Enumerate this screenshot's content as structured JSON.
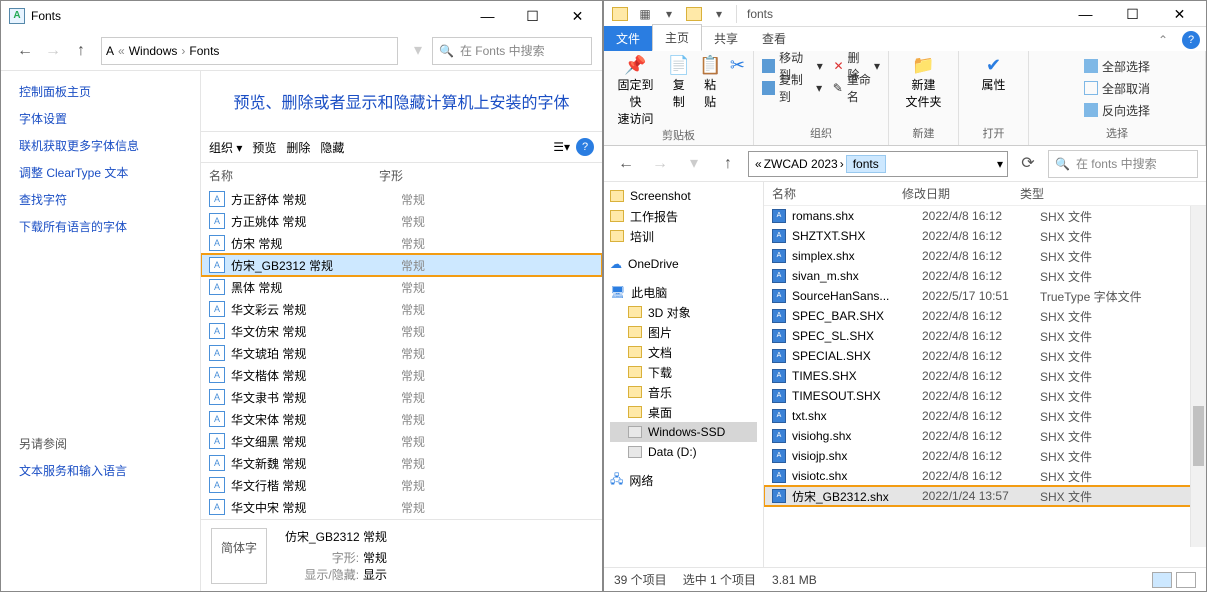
{
  "left": {
    "title": "Fonts",
    "winbtns": {
      "min": "—",
      "max": "☐",
      "close": "✕"
    },
    "nav": {
      "back": "←",
      "fwd": "→",
      "up": "↑"
    },
    "crumbs": [
      "Windows",
      "Fonts"
    ],
    "search_ph": "在 Fonts 中搜索",
    "side": {
      "home": "控制面板主页",
      "links": [
        "字体设置",
        "联机获取更多字体信息",
        "调整 ClearType 文本",
        "查找字符",
        "下载所有语言的字体"
      ],
      "seealso": "另请参阅",
      "seealso_link": "文本服务和输入语言"
    },
    "heading": "预览、删除或者显示和隐藏计算机上安装的字体",
    "toolbar": {
      "org": "组织",
      "drop": "▾",
      "preview": "预览",
      "delete": "删除",
      "hide": "隐藏",
      "viewicon": "☰▾",
      "help": "?"
    },
    "columns": {
      "name": "名称",
      "style": "字形"
    },
    "rows": [
      {
        "n": "方正舒体 常规",
        "s": "常规"
      },
      {
        "n": "方正姚体 常规",
        "s": "常规"
      },
      {
        "n": "仿宋 常规",
        "s": "常规"
      },
      {
        "n": "仿宋_GB2312 常规",
        "s": "常规",
        "sel": true,
        "hi": true
      },
      {
        "n": "黑体 常规",
        "s": "常规"
      },
      {
        "n": "华文彩云 常规",
        "s": "常规"
      },
      {
        "n": "华文仿宋 常规",
        "s": "常规"
      },
      {
        "n": "华文琥珀 常规",
        "s": "常规"
      },
      {
        "n": "华文楷体 常规",
        "s": "常规"
      },
      {
        "n": "华文隶书 常规",
        "s": "常规"
      },
      {
        "n": "华文宋体 常规",
        "s": "常规"
      },
      {
        "n": "华文细黑 常规",
        "s": "常规"
      },
      {
        "n": "华文新魏 常规",
        "s": "常规"
      },
      {
        "n": "华文行楷 常规",
        "s": "常规"
      },
      {
        "n": "华文中宋 常规",
        "s": "常规"
      }
    ],
    "preview": {
      "thumb": "简体字",
      "name": "仿宋_GB2312 常规",
      "k1": "字形:",
      "v1": "常规",
      "k2": "显示/隐藏:",
      "v2": "显示"
    }
  },
  "right": {
    "qat_title": "fonts",
    "winbtns": {
      "min": "—",
      "max": "☐",
      "close": "✕"
    },
    "tabs": {
      "file": "文件",
      "home": "主页",
      "share": "共享",
      "view": "查看"
    },
    "ribbon": {
      "pin": {
        "icon": "📌",
        "l1": "固定到快",
        "l2": "速访问"
      },
      "copy": {
        "icon": "📄",
        "l": "复制"
      },
      "paste": {
        "icon": "📋",
        "l": "粘贴"
      },
      "cut": {
        "icon": "✂"
      },
      "clip_lbl": "剪贴板",
      "moveto": "移动到",
      "copyto": "复制到",
      "del": "删除",
      "rename": "重命名",
      "org_lbl": "组织",
      "newfolder_l1": "新建",
      "newfolder_l2": "文件夹",
      "new_lbl": "新建",
      "props": "属性",
      "open_lbl": "打开",
      "selall": "全部选择",
      "selnone": "全部取消",
      "selinv": "反向选择",
      "sel_lbl": "选择"
    },
    "nav": {
      "back": "←",
      "fwd": "→",
      "up": "↑",
      "hist": "🕐",
      "refresh": "⟳"
    },
    "crumbs": {
      "pre": "«",
      "a": "ZWCAD 2023",
      "b": "fonts"
    },
    "search_ph": "在 fonts 中搜索",
    "tree": [
      {
        "t": "Screenshot",
        "i": "f"
      },
      {
        "t": "工作报告",
        "i": "f"
      },
      {
        "t": "培训",
        "i": "f"
      },
      {
        "t": "",
        "sp": 1
      },
      {
        "t": "OneDrive",
        "i": "cloud"
      },
      {
        "t": "",
        "sp": 1
      },
      {
        "t": "此电脑",
        "i": "pc"
      },
      {
        "t": "3D 对象",
        "i": "f",
        "ind": 1
      },
      {
        "t": "图片",
        "i": "f",
        "ind": 1
      },
      {
        "t": "文档",
        "i": "f",
        "ind": 1
      },
      {
        "t": "下载",
        "i": "f",
        "ind": 1
      },
      {
        "t": "音乐",
        "i": "f",
        "ind": 1
      },
      {
        "t": "桌面",
        "i": "f",
        "ind": 1
      },
      {
        "t": "Windows-SSD",
        "i": "d",
        "ind": 1,
        "sel": true
      },
      {
        "t": "Data (D:)",
        "i": "d",
        "ind": 1
      },
      {
        "t": "",
        "sp": 1
      },
      {
        "t": "网络",
        "i": "net"
      }
    ],
    "fcols": {
      "name": "名称",
      "date": "修改日期",
      "type": "类型"
    },
    "files": [
      {
        "n": "romans.shx",
        "d": "2022/4/8 16:12",
        "t": "SHX 文件"
      },
      {
        "n": "SHZTXT.SHX",
        "d": "2022/4/8 16:12",
        "t": "SHX 文件"
      },
      {
        "n": "simplex.shx",
        "d": "2022/4/8 16:12",
        "t": "SHX 文件"
      },
      {
        "n": "sivan_m.shx",
        "d": "2022/4/8 16:12",
        "t": "SHX 文件"
      },
      {
        "n": "SourceHanSans...",
        "d": "2022/5/17 10:51",
        "t": "TrueType 字体文件",
        "tt": 1
      },
      {
        "n": "SPEC_BAR.SHX",
        "d": "2022/4/8 16:12",
        "t": "SHX 文件"
      },
      {
        "n": "SPEC_SL.SHX",
        "d": "2022/4/8 16:12",
        "t": "SHX 文件"
      },
      {
        "n": "SPECIAL.SHX",
        "d": "2022/4/8 16:12",
        "t": "SHX 文件"
      },
      {
        "n": "TIMES.SHX",
        "d": "2022/4/8 16:12",
        "t": "SHX 文件"
      },
      {
        "n": "TIMESOUT.SHX",
        "d": "2022/4/8 16:12",
        "t": "SHX 文件"
      },
      {
        "n": "txt.shx",
        "d": "2022/4/8 16:12",
        "t": "SHX 文件"
      },
      {
        "n": "visiohg.shx",
        "d": "2022/4/8 16:12",
        "t": "SHX 文件"
      },
      {
        "n": "visiojp.shx",
        "d": "2022/4/8 16:12",
        "t": "SHX 文件"
      },
      {
        "n": "visiotc.shx",
        "d": "2022/4/8 16:12",
        "t": "SHX 文件"
      },
      {
        "n": "仿宋_GB2312.shx",
        "d": "2022/1/24 13:57",
        "t": "SHX 文件",
        "hi": true
      }
    ],
    "status": {
      "count": "39 个项目",
      "sel": "选中 1 个项目",
      "size": "3.81 MB"
    }
  }
}
